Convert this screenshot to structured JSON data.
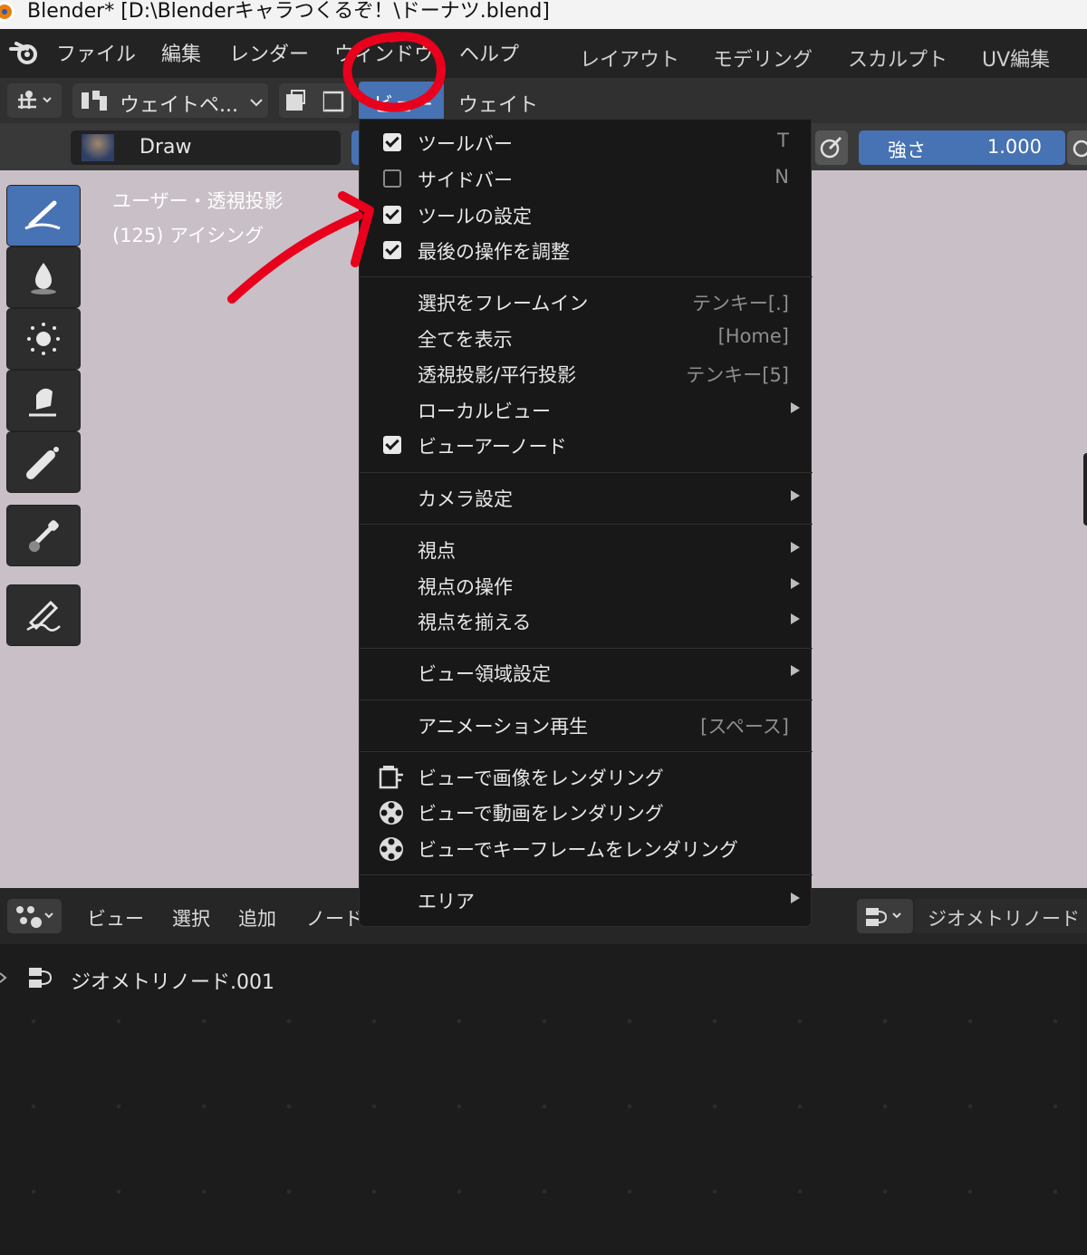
{
  "titlebar": {
    "title": "Blender* [D:\\Blenderキャラつくるぞ！\\ドーナツ.blend]"
  },
  "topmenu": {
    "items": [
      "ファイル",
      "編集",
      "レンダー",
      "ウィンドウ",
      "ヘルプ"
    ],
    "workspaces": [
      "レイアウト",
      "モデリング",
      "スカルプト",
      "UV編集"
    ]
  },
  "header": {
    "mode": "ウェイトペ...",
    "menus": [
      "ビュー",
      "ウェイト"
    ]
  },
  "toolsettings": {
    "brush": "Draw",
    "strength_label": "強さ",
    "strength_value": "1.000"
  },
  "viewport": {
    "overlay_line1": "ユーザー・透視投影",
    "overlay_line2": "(125) アイシング",
    "bg_color": "#c9bfc7"
  },
  "view_menu": {
    "items": [
      {
        "label": "ツールバー",
        "shortcut": "T",
        "checked": true
      },
      {
        "label": "サイドバー",
        "shortcut": "N",
        "checked": false
      },
      {
        "label": "ツールの設定",
        "shortcut": "",
        "checked": true
      },
      {
        "label": "最後の操作を調整",
        "shortcut": "",
        "checked": true
      },
      {
        "label": "選択をフレームイン",
        "shortcut": "テンキー[.]"
      },
      {
        "label": "全てを表示",
        "shortcut": "[Home]"
      },
      {
        "label": "透視投影/平行投影",
        "shortcut": "テンキー[5]"
      },
      {
        "label": "ローカルビュー",
        "submenu": true
      },
      {
        "label": "ビューアーノード",
        "checked": true
      },
      {
        "label": "カメラ設定",
        "submenu": true
      },
      {
        "label": "視点",
        "submenu": true
      },
      {
        "label": "視点の操作",
        "submenu": true
      },
      {
        "label": "視点を揃える",
        "submenu": true
      },
      {
        "label": "ビュー領域設定",
        "submenu": true
      },
      {
        "label": "アニメーション再生",
        "shortcut": "[スペース]"
      },
      {
        "label": "ビューで画像をレンダリング",
        "icon": "render-image-icon"
      },
      {
        "label": "ビューで動画をレンダリング",
        "icon": "render-animation-icon"
      },
      {
        "label": "ビューでキーフレームをレンダリング",
        "icon": "render-keyframes-icon"
      },
      {
        "label": "エリア",
        "submenu": true
      }
    ]
  },
  "node_editor": {
    "menus": [
      "ビュー",
      "選択",
      "追加",
      "ノード"
    ],
    "tree_name": "ジオメトリノード",
    "breadcrumb": "ジオメトリノード.001"
  },
  "colors": {
    "accent": "#4772b3",
    "menu_bg": "#181818",
    "annotation": "#e8001c"
  }
}
